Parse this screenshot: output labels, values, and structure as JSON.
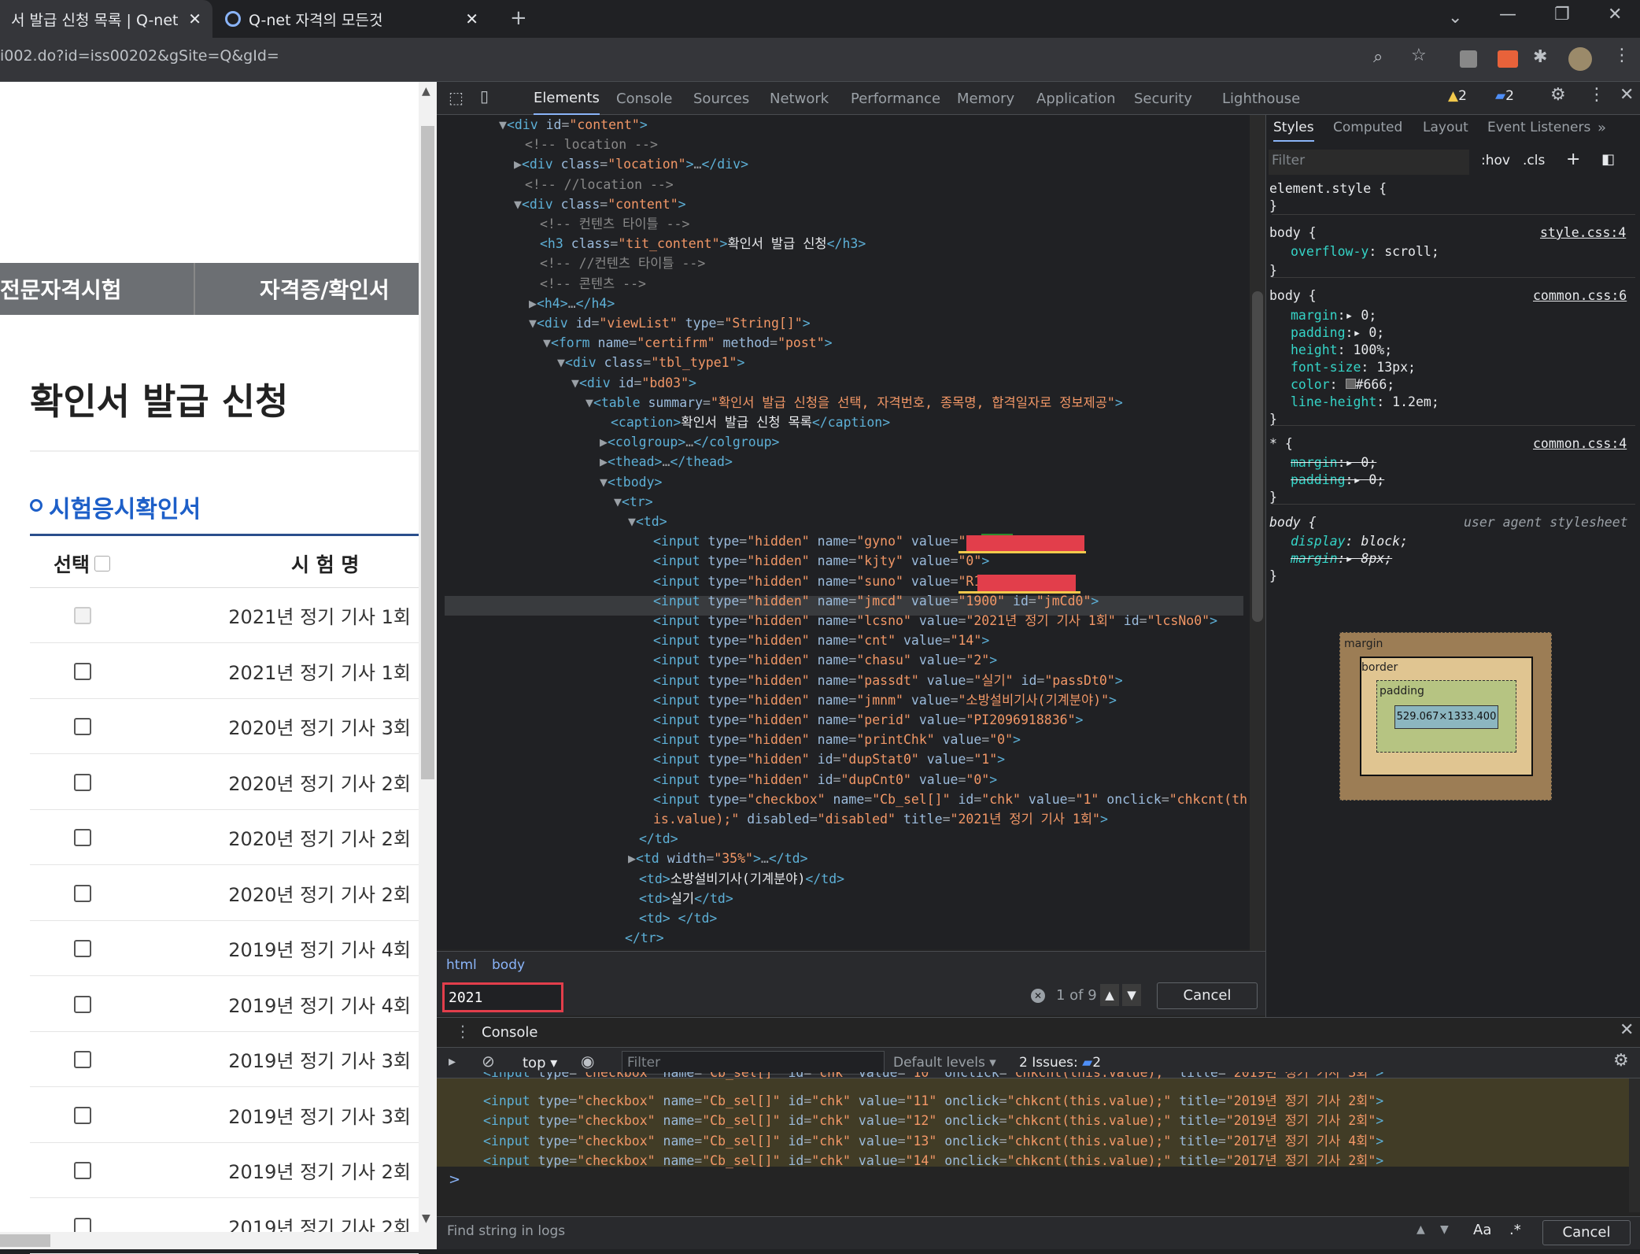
{
  "browser": {
    "tabs": [
      {
        "title": "서 발급 신청 목록 | Q-net"
      },
      {
        "title": "Q-net 자격의 모든것"
      }
    ],
    "url": "i002.do?id=iss00202&gSite=Q&gId="
  },
  "page": {
    "nav": [
      "전문자격시험",
      "자격증/확인서"
    ],
    "title": "확인서 발급 신청",
    "section_title": "시험응시확인서",
    "table_headers": [
      "선택",
      "시 험 명"
    ],
    "rows": [
      "2021년 정기 기사 1회",
      "2021년 정기 기사 1회",
      "2020년 정기 기사 3회",
      "2020년 정기 기사 2회",
      "2020년 정기 기사 2회",
      "2020년 정기 기사 2회",
      "2019년 정기 기사 4회",
      "2019년 정기 기사 4회",
      "2019년 정기 기사 3회",
      "2019년 정기 기사 3회",
      "2019년 정기 기사 2회",
      "2019년 정기 기사 2회"
    ]
  },
  "devtools": {
    "tabs": [
      "Elements",
      "Console",
      "Sources",
      "Network",
      "Performance",
      "Memory",
      "Application",
      "Security",
      "Lighthouse"
    ],
    "warnings": "2",
    "messages": "2",
    "styles_tabs": [
      "Styles",
      "Computed",
      "Layout",
      "Event Listeners"
    ],
    "styles_filter_placeholder": "Filter",
    "hov": ":hov",
    "cls": ".cls",
    "box_model": {
      "margin": "margin",
      "border": "border",
      "padding": "padding",
      "content": "529.067×1333.400",
      "dash": "–"
    },
    "crumbs": [
      "html",
      "body"
    ],
    "search_value": "2021",
    "search_count": "1 of 9",
    "cancel": "Cancel",
    "console_tab": "Console",
    "context": "top",
    "console_filter_placeholder": "Filter",
    "default_levels": "Default levels",
    "issues": "2 Issues:",
    "issues_count": "2",
    "find_placeholder": "Find string in logs",
    "find_aa": "Aa",
    "find_regex": ".*",
    "prompt": ">"
  }
}
